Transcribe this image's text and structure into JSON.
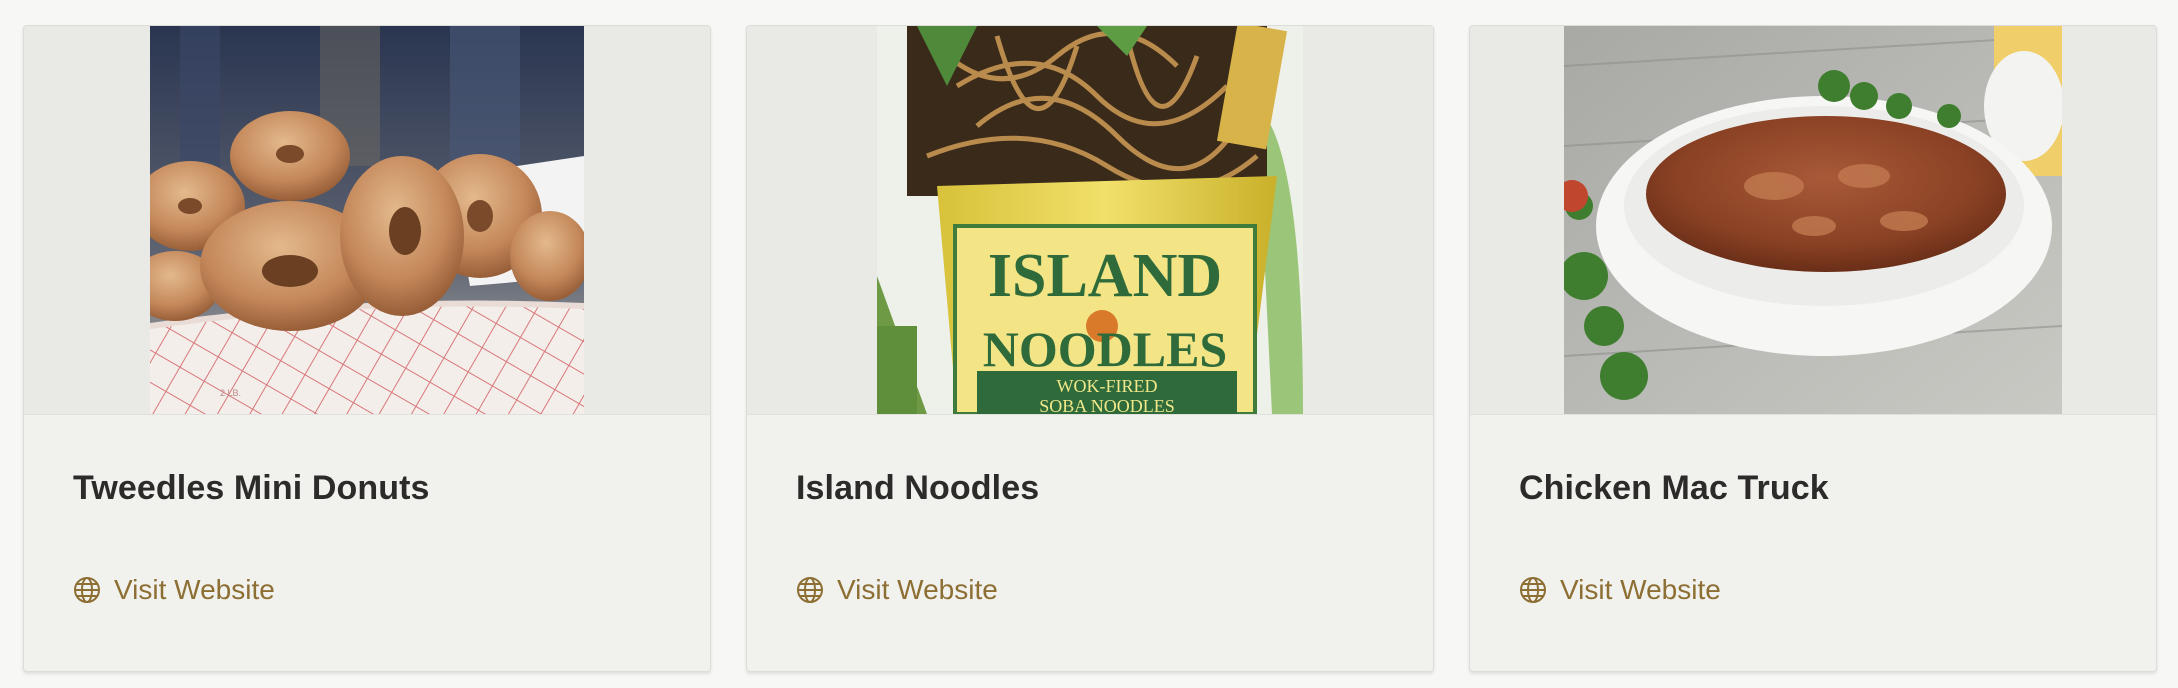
{
  "cards": [
    {
      "title": "Tweedles Mini Donuts",
      "link_label": "Visit Website",
      "image_subject": "mini sugar donuts in a paper tray",
      "tray_text": "2 LB."
    },
    {
      "title": "Island Noodles",
      "link_label": "Visit Website",
      "image_subject": "cup of wok-fired soba noodles",
      "cup_text_line1": "ISLAND",
      "cup_text_line2": "NOODLES",
      "cup_band_text1": "WOK-FIRED",
      "cup_band_text2": "SOBA NOODLES"
    },
    {
      "title": "Chicken Mac Truck",
      "link_label": "Visit Website",
      "image_subject": "white bowl of saucy chicken with parsley"
    }
  ],
  "icons": {
    "link_icon": "globe-icon"
  },
  "colors": {
    "link": "#8d6f33",
    "title": "#2d2b2a",
    "card_bg": "#f1f1ee"
  }
}
